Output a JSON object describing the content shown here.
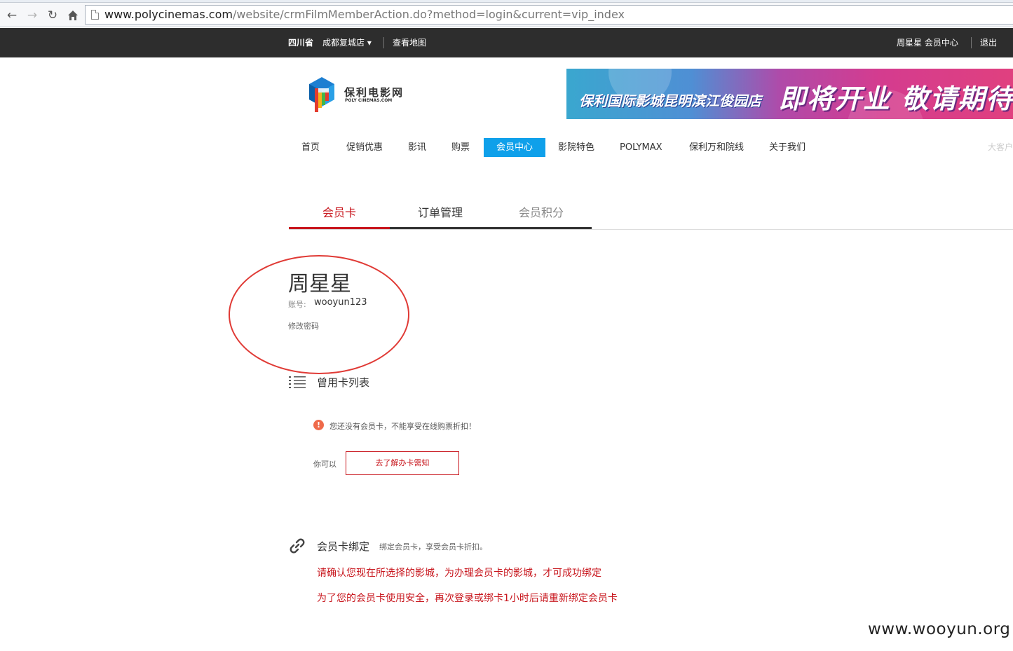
{
  "browser": {
    "url_host": "www.polycinemas.com",
    "url_path": "/website/crmFilmMemberAction.do?method=login&current=vip_index"
  },
  "topbar": {
    "province": "四川省",
    "city": "成都复城店 ▾",
    "map": "查看地图",
    "user": "周星星 会员中心",
    "logout": "退出"
  },
  "logo": {
    "cn": "保利电影网",
    "en": "POLY CINEMAS.COM"
  },
  "banner": {
    "small": "保利国际影城昆明滨江俊园店",
    "big": "即将开业 敬请期待"
  },
  "nav": {
    "items": [
      "首页",
      "促销优惠",
      "影讯",
      "购票",
      "会员中心",
      "影院特色",
      "POLYMAX",
      "保利万和院线",
      "关于我们"
    ],
    "corner": "大客户"
  },
  "tabs": [
    "会员卡",
    "订单管理",
    "会员积分"
  ],
  "profile": {
    "name": "周星星",
    "account_label": "账号:",
    "account_value": "wooyun123",
    "change_password": "修改密码"
  },
  "cards": {
    "title": "曾用卡列表",
    "warning": "您还没有会员卡，不能享受在线购票折扣！",
    "can_label": "你可以",
    "learn_button": "去了解办卡需知"
  },
  "binding": {
    "title": "会员卡绑定",
    "subtitle": "绑定会员卡，享受会员卡折扣。",
    "notice1": "请确认您现在所选择的影城，为办理会员卡的影城，才可成功绑定",
    "notice2": "为了您的会员卡使用安全，再次登录或绑卡1小时后请重新绑定会员卡"
  },
  "watermark": "www.wooyun.org",
  "colors": {
    "accent_red": "#c8161d",
    "nav_active": "#0fa0ea",
    "topbar": "#2d2d2d",
    "annotation_circle": "#e03a35"
  }
}
